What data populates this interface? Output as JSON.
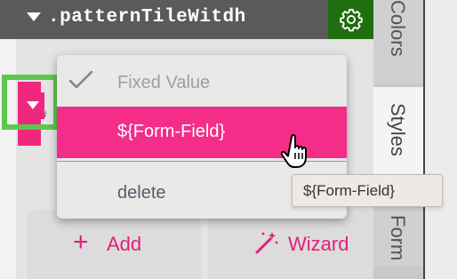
{
  "header": {
    "title": ".patternTileWitdh",
    "settings_icon": "gear-icon"
  },
  "field": {
    "hint": "#"
  },
  "menu": {
    "items": [
      {
        "label": "Fixed Value",
        "icon": "check-icon",
        "state": "checked"
      },
      {
        "label": "${Form-Field}",
        "state": "highlighted"
      },
      {
        "label": "delete"
      }
    ]
  },
  "tooltip": {
    "text": "${Form-Field}"
  },
  "buttons": {
    "add": {
      "label": "Add",
      "icon": "plus-icon"
    },
    "wizard": {
      "label": "Wizard",
      "icon": "magic-wand-icon"
    }
  },
  "tabs": [
    {
      "label": "Colors"
    },
    {
      "label": "Styles",
      "active": true
    },
    {
      "label": "Form"
    }
  ],
  "colors": {
    "accent": "#f32d88",
    "header_bg": "#5a5a5a",
    "gear_bg": "#1f6e0f",
    "highlight_outline": "#5cc84b"
  }
}
